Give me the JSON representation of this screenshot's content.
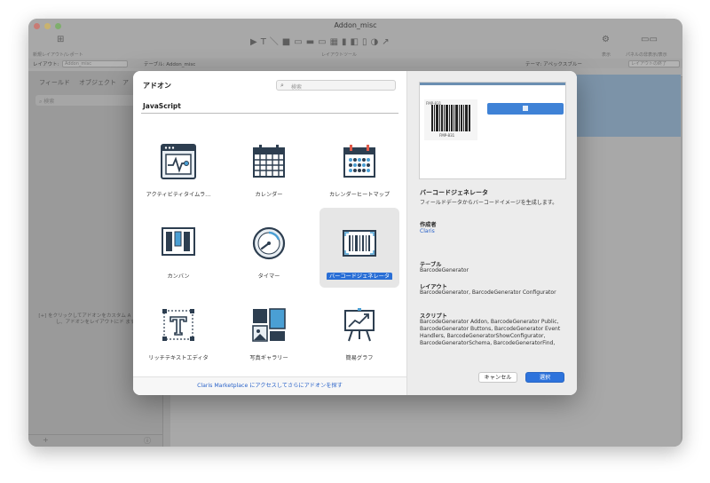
{
  "window": {
    "title": "Addon_misc",
    "toolbar_left_label": "新規レイアウト/レポート",
    "toolbar_center_label": "レイアウトツール",
    "toolbar_right_label_1": "表示",
    "toolbar_right_label_2": "パネルの非表示/表示"
  },
  "subbar": {
    "layout_label": "レイアウト:",
    "layout_value": "Addon_misc",
    "table_label": "テーブル: Addon_misc",
    "theme_label": "テーマ: アペックスブルー",
    "exit_layout": "レイアウトの終了"
  },
  "left_panel": {
    "tab_fields": "フィールド",
    "tab_objects": "オブジェクト",
    "tab_addons": "ア",
    "search_placeholder": "検索",
    "hint": "[+] をクリックしてアドオンをカスタム A ンストールし、アドオンをレイアウトにド ます。"
  },
  "dialog": {
    "title": "アドオン",
    "search_placeholder": "検索",
    "category": "JavaScript",
    "footer_link": "Claris Marketplace にアクセスしてさらにアドオンを探す",
    "addons": [
      {
        "label": "アクティビティタイムラ…",
        "icon": "activity-timeline-icon"
      },
      {
        "label": "カレンダー",
        "icon": "calendar-icon"
      },
      {
        "label": "カレンダーヒートマップ",
        "icon": "calendar-heatmap-icon"
      },
      {
        "label": "カンバン",
        "icon": "kanban-icon"
      },
      {
        "label": "タイマー",
        "icon": "timer-icon"
      },
      {
        "label": "バーコードジェネレータ",
        "icon": "barcode-icon",
        "selected": true
      },
      {
        "label": "リッチテキストエディタ",
        "icon": "rich-text-icon"
      },
      {
        "label": "写真ギャラリー",
        "icon": "photo-gallery-icon"
      },
      {
        "label": "簡易グラフ",
        "icon": "simple-chart-icon"
      }
    ],
    "detail": {
      "preview_card_title": "FMP-831",
      "preview_barcode_text": "FMP-831",
      "name": "バーコードジェネレータ",
      "description": "フィールドデータからバーコードイメージを生成します。",
      "author_label": "作成者",
      "author": "Claris",
      "table_label": "テーブル",
      "table_value": "BarcodeGenerator",
      "layout_label": "レイアウト",
      "layout_value": "BarcodeGenerator, BarcodeGenerator Configurator",
      "script_label": "スクリプト",
      "script_value": "BarcodeGenerator Addon, BarcodeGenerator Public, BarcodeGenerator Buttons, BarcodeGenerator Event Handlers, BarcodeGeneratorShowConfigurator, BarcodeGeneratorSchema, BarcodeGeneratorFind,"
    },
    "cancel_label": "キャンセル",
    "select_label": "選択"
  },
  "colors": {
    "accent": "#2d73dc",
    "link": "#2962c8",
    "icon_dark": "#2d3e50",
    "icon_blue": "#4a9fd4"
  }
}
